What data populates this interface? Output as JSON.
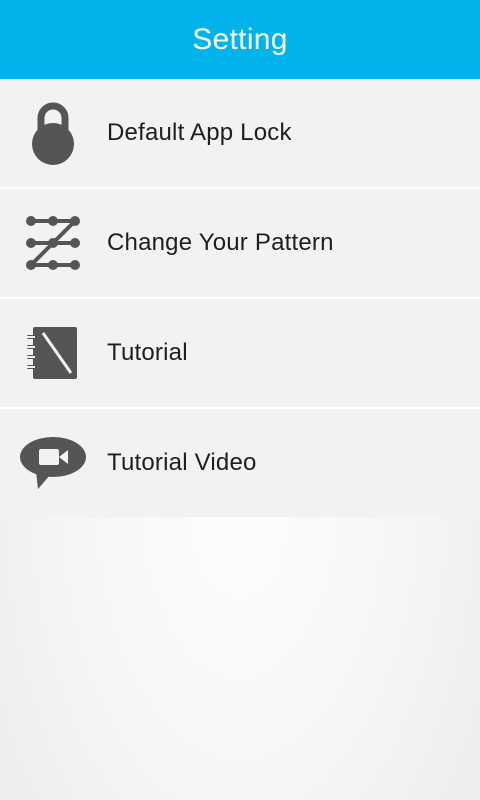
{
  "header": {
    "title": "Setting",
    "background_color": "#00b3ea"
  },
  "menu": {
    "items": [
      {
        "label": "Default App Lock",
        "icon": "padlock-icon"
      },
      {
        "label": "Change Your Pattern",
        "icon": "pattern-grid-icon"
      },
      {
        "label": "Tutorial",
        "icon": "notebook-icon"
      },
      {
        "label": "Tutorial Video",
        "icon": "video-speech-bubble-icon"
      }
    ]
  },
  "colors": {
    "icon": "#555555",
    "item_background": "#f2f2f2",
    "text": "#1e1e1e"
  }
}
